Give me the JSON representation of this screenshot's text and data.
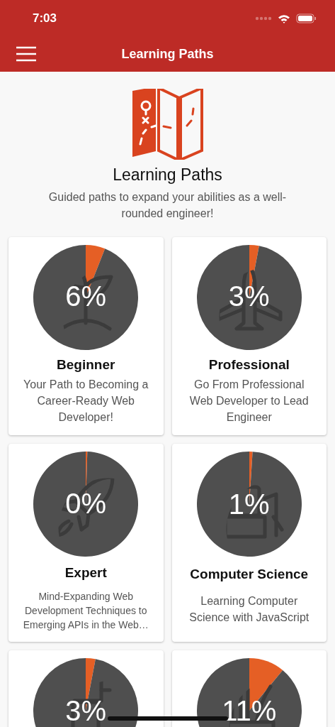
{
  "status_bar": {
    "time": "7:03"
  },
  "nav_bar": {
    "title": "Learning Paths"
  },
  "intro": {
    "title": "Learning Paths",
    "subtitle": "Guided paths to expand your abilities as a well-rounded engineer!"
  },
  "paths": [
    {
      "percent": "6%",
      "chart_data": {
        "type": "pie",
        "values": [
          6,
          94
        ]
      },
      "title": "Beginner",
      "description": "Your Path to Becoming a Career-Ready Web Developer!"
    },
    {
      "percent": "3%",
      "chart_data": {
        "type": "pie",
        "values": [
          3,
          97
        ]
      },
      "title": "Professional",
      "description": "Go From Professional Web Developer to Lead Engineer"
    },
    {
      "percent": "0%",
      "chart_data": {
        "type": "pie",
        "values": [
          0.5,
          99.5
        ]
      },
      "title": "Expert",
      "description": "Mind-Expanding Web Development Techniques to Emerging APIs in the Web…"
    },
    {
      "percent": "1%",
      "chart_data": {
        "type": "pie",
        "values": [
          1,
          99
        ]
      },
      "title": "Computer Science",
      "description": "Learning Computer Science with JavaScript"
    },
    {
      "percent": "3%",
      "chart_data": {
        "type": "pie",
        "values": [
          3,
          97
        ]
      }
    },
    {
      "percent": "11%",
      "chart_data": {
        "type": "pie",
        "values": [
          11,
          89
        ]
      }
    }
  ]
}
